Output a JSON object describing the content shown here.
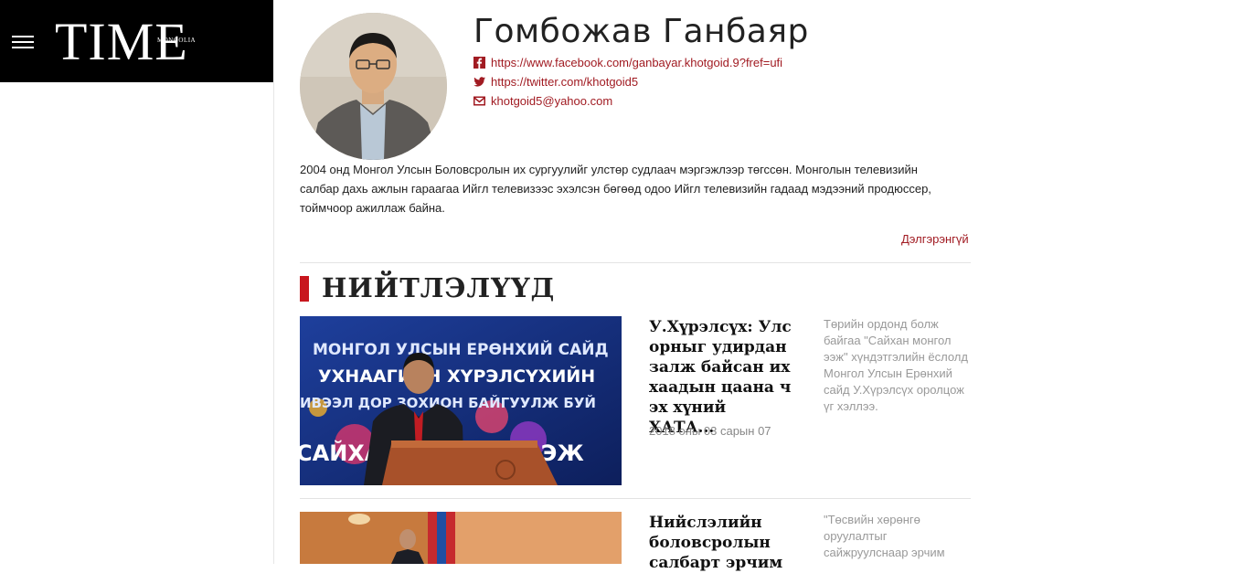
{
  "header": {
    "logo": "TIME",
    "logo_sub": "MONGOLIA",
    "menu_icon": "hamburger-icon"
  },
  "author": {
    "name": "Гомбожав Ганбаяр",
    "facebook": "https://www.facebook.com/ganbayar.khotgoid.9?fref=ufi",
    "twitter": "https://twitter.com/khotgoid5",
    "email": "khotgoid5@yahoo.com",
    "bio": "2004 онд Монгол Улсын Боловсролын их сургуулийг улстөр судлаач мэргэжлээр төгссөн. Монголын телевизийн салбар дахь ажлын гараагаа Ийгл телевизээс эхэлсэн бөгөөд одоо Ийгл телевизийн гадаад мэдээний продюссер, тоймчоор ажиллаж байна.",
    "more_label": "Дэлгэрэнгүй"
  },
  "section": {
    "title": "НИЙТЛЭЛҮҮД"
  },
  "articles": [
    {
      "title": "У.Хүрэлсүх: Улс орныг удирдан залж байсан их хаадын цаана ч эх хүний ХАТА...",
      "date": "2018 оны 03 сарын 07",
      "summary": "Төрийн ордонд болж байгаа \"Сайхан монгол ээж\" хүндэтгэлийн ёслолд Монгол Улсын Ерөнхий сайд У.Хүрэлсүх оролцож үг хэллээ.",
      "image_text": [
        "МОНГОЛ УЛСЫН ЕРӨНХИЙ САЙД",
        "УХНААГИЙН ХҮРЭЛСҮХИЙН",
        "ИВЭЭЛ ДОР ЗОХИОН БАЙГУУЛЖ БУЙ",
        "САЙХАН МОНГОЛ ЭЭЖ"
      ]
    },
    {
      "title": "Нийслэлийн боловсролын салбарт эрчим",
      "summary": "\"Төсвийн хөрөнгө оруулалтыг сайжруулснаар эрчим"
    }
  ],
  "colors": {
    "accent": "#c8171e",
    "link": "#a11b22",
    "header_bg": "#000000"
  }
}
